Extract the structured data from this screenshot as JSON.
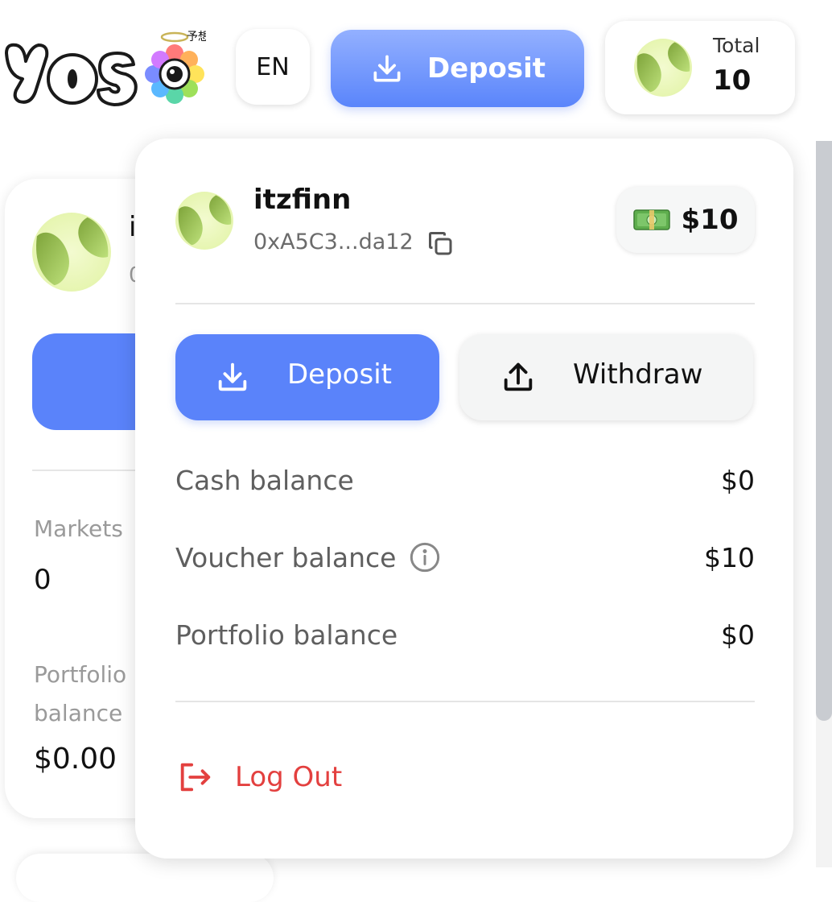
{
  "header": {
    "logo_text": "yoso 予想",
    "language_button": "EN",
    "deposit_button": "Deposit",
    "total_label": "Total",
    "total_value": "10"
  },
  "background_card": {
    "name_fragment": "i",
    "sub_fragment": "0",
    "markets_label": "Markets",
    "markets_value": "0",
    "portfolio_label": "Portfolio balance",
    "portfolio_value": "$0.00"
  },
  "dropdown": {
    "username": "itzfinn",
    "address": "0xA5C3...da12",
    "balance_pill": "$10",
    "deposit_button": "Deposit",
    "withdraw_button": "Withdraw",
    "rows": [
      {
        "label": "Cash balance",
        "value": "$0"
      },
      {
        "label": "Voucher balance",
        "value": "$10"
      },
      {
        "label": "Portfolio balance",
        "value": "$0"
      }
    ],
    "logout_label": "Log Out"
  },
  "colors": {
    "primary": "#5a83fa",
    "logout": "#e3403f",
    "avatar_green": "#9cc54a"
  },
  "icons": [
    "download-icon",
    "upload-icon",
    "copy-icon",
    "info-icon",
    "logout-icon",
    "money-icon",
    "avatar-icon"
  ]
}
